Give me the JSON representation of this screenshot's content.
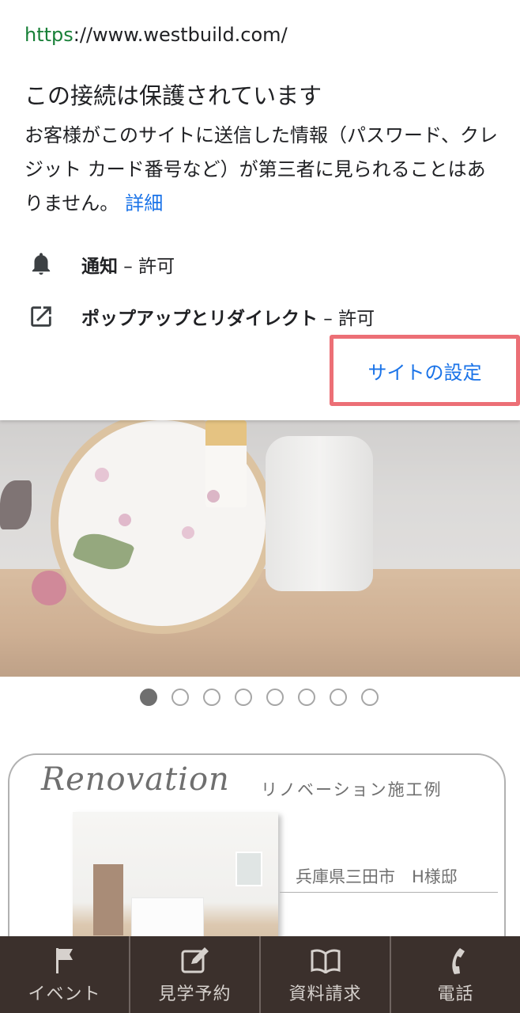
{
  "site_info": {
    "url_scheme": "https",
    "url_rest": "://www.westbuild.com/",
    "connection_title": "この接続は保護されています",
    "connection_description": "お客様がこのサイトに送信した情報（パスワード、クレジット カード番号など）が第三者に見られることはありません。",
    "details_link": "詳細",
    "permissions": [
      {
        "icon": "bell-icon",
        "name": "通知",
        "state": " – 許可"
      },
      {
        "icon": "open-in-new-icon",
        "name": "ポップアップとリダイレクト",
        "state": " – 許可"
      }
    ],
    "site_settings_label": "サイトの設定",
    "highlight_color": "#ec6f76",
    "accent_color": "#1a73e8"
  },
  "carousel": {
    "total_slides": 8,
    "active_index": 0
  },
  "renovation": {
    "title": "Renovation",
    "subtitle": "リノベーション施工例",
    "caption": "兵庫県三田市　H様邸"
  },
  "bottom_nav": {
    "items": [
      {
        "icon": "flag-icon",
        "label": "イベント"
      },
      {
        "icon": "edit-icon",
        "label": "見学予約"
      },
      {
        "icon": "book-icon",
        "label": "資料請求"
      },
      {
        "icon": "phone-icon",
        "label": "電話"
      }
    ],
    "background_color": "#3b302c"
  }
}
